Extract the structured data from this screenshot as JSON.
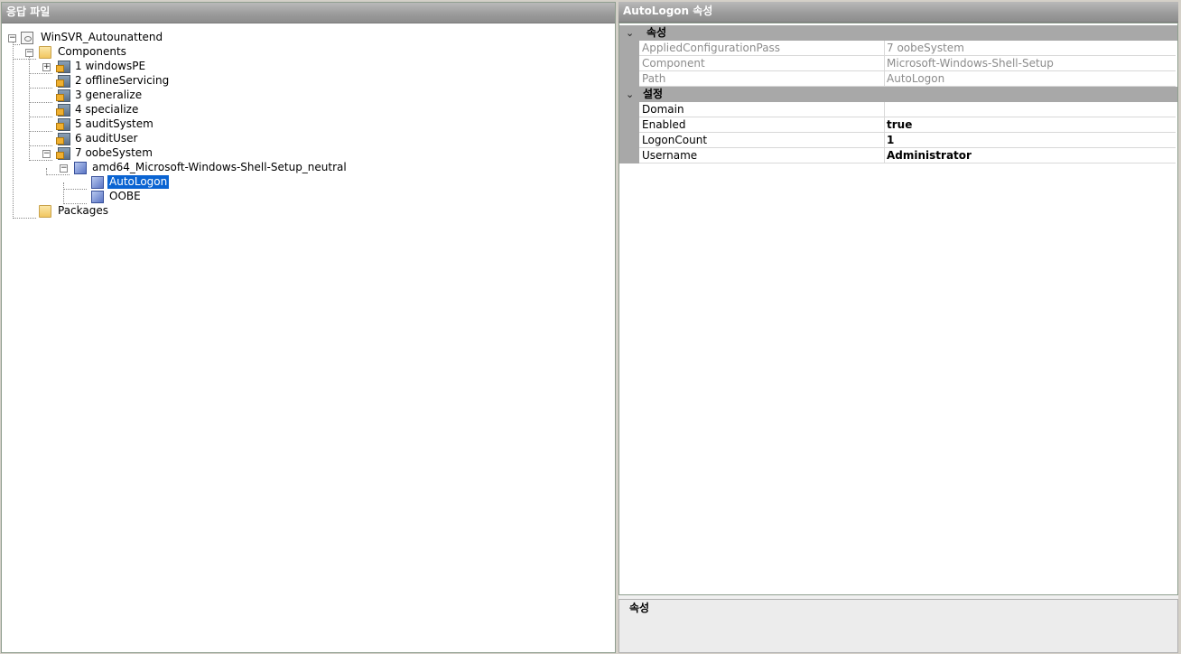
{
  "left_panel": {
    "title": "응답 파일"
  },
  "tree": {
    "root": "WinSVR_Autounattend",
    "components": "Components",
    "passes": [
      "1 windowsPE",
      "2 offlineServicing",
      "3 generalize",
      "4 specialize",
      "5 auditSystem",
      "6 auditUser",
      "7 oobeSystem"
    ],
    "component_node": "amd64_Microsoft-Windows-Shell-Setup_neutral",
    "settings": [
      "AutoLogon",
      "OOBE"
    ],
    "packages": "Packages",
    "selected": "AutoLogon"
  },
  "right_panel": {
    "title": "AutoLogon 속성"
  },
  "properties": {
    "category_props": "속성",
    "category_settings": "설정",
    "readonly": [
      {
        "name": "AppliedConfigurationPass",
        "value": "7 oobeSystem"
      },
      {
        "name": "Component",
        "value": "Microsoft-Windows-Shell-Setup"
      },
      {
        "name": "Path",
        "value": "AutoLogon"
      }
    ],
    "settings": [
      {
        "name": "Domain",
        "value": ""
      },
      {
        "name": "Enabled",
        "value": "true"
      },
      {
        "name": "LogonCount",
        "value": "1"
      },
      {
        "name": "Username",
        "value": "Administrator"
      }
    ]
  },
  "description": {
    "title": "속성"
  },
  "icons": {
    "expander_collapsed": "plus-box-icon",
    "expander_expanded": "minus-box-icon",
    "category_chevron": "chevron-down-icon"
  },
  "colors": {
    "selection": "#0a64d2",
    "category_bg": "#a8a8a8",
    "titlebar": "#9a9a9a"
  }
}
